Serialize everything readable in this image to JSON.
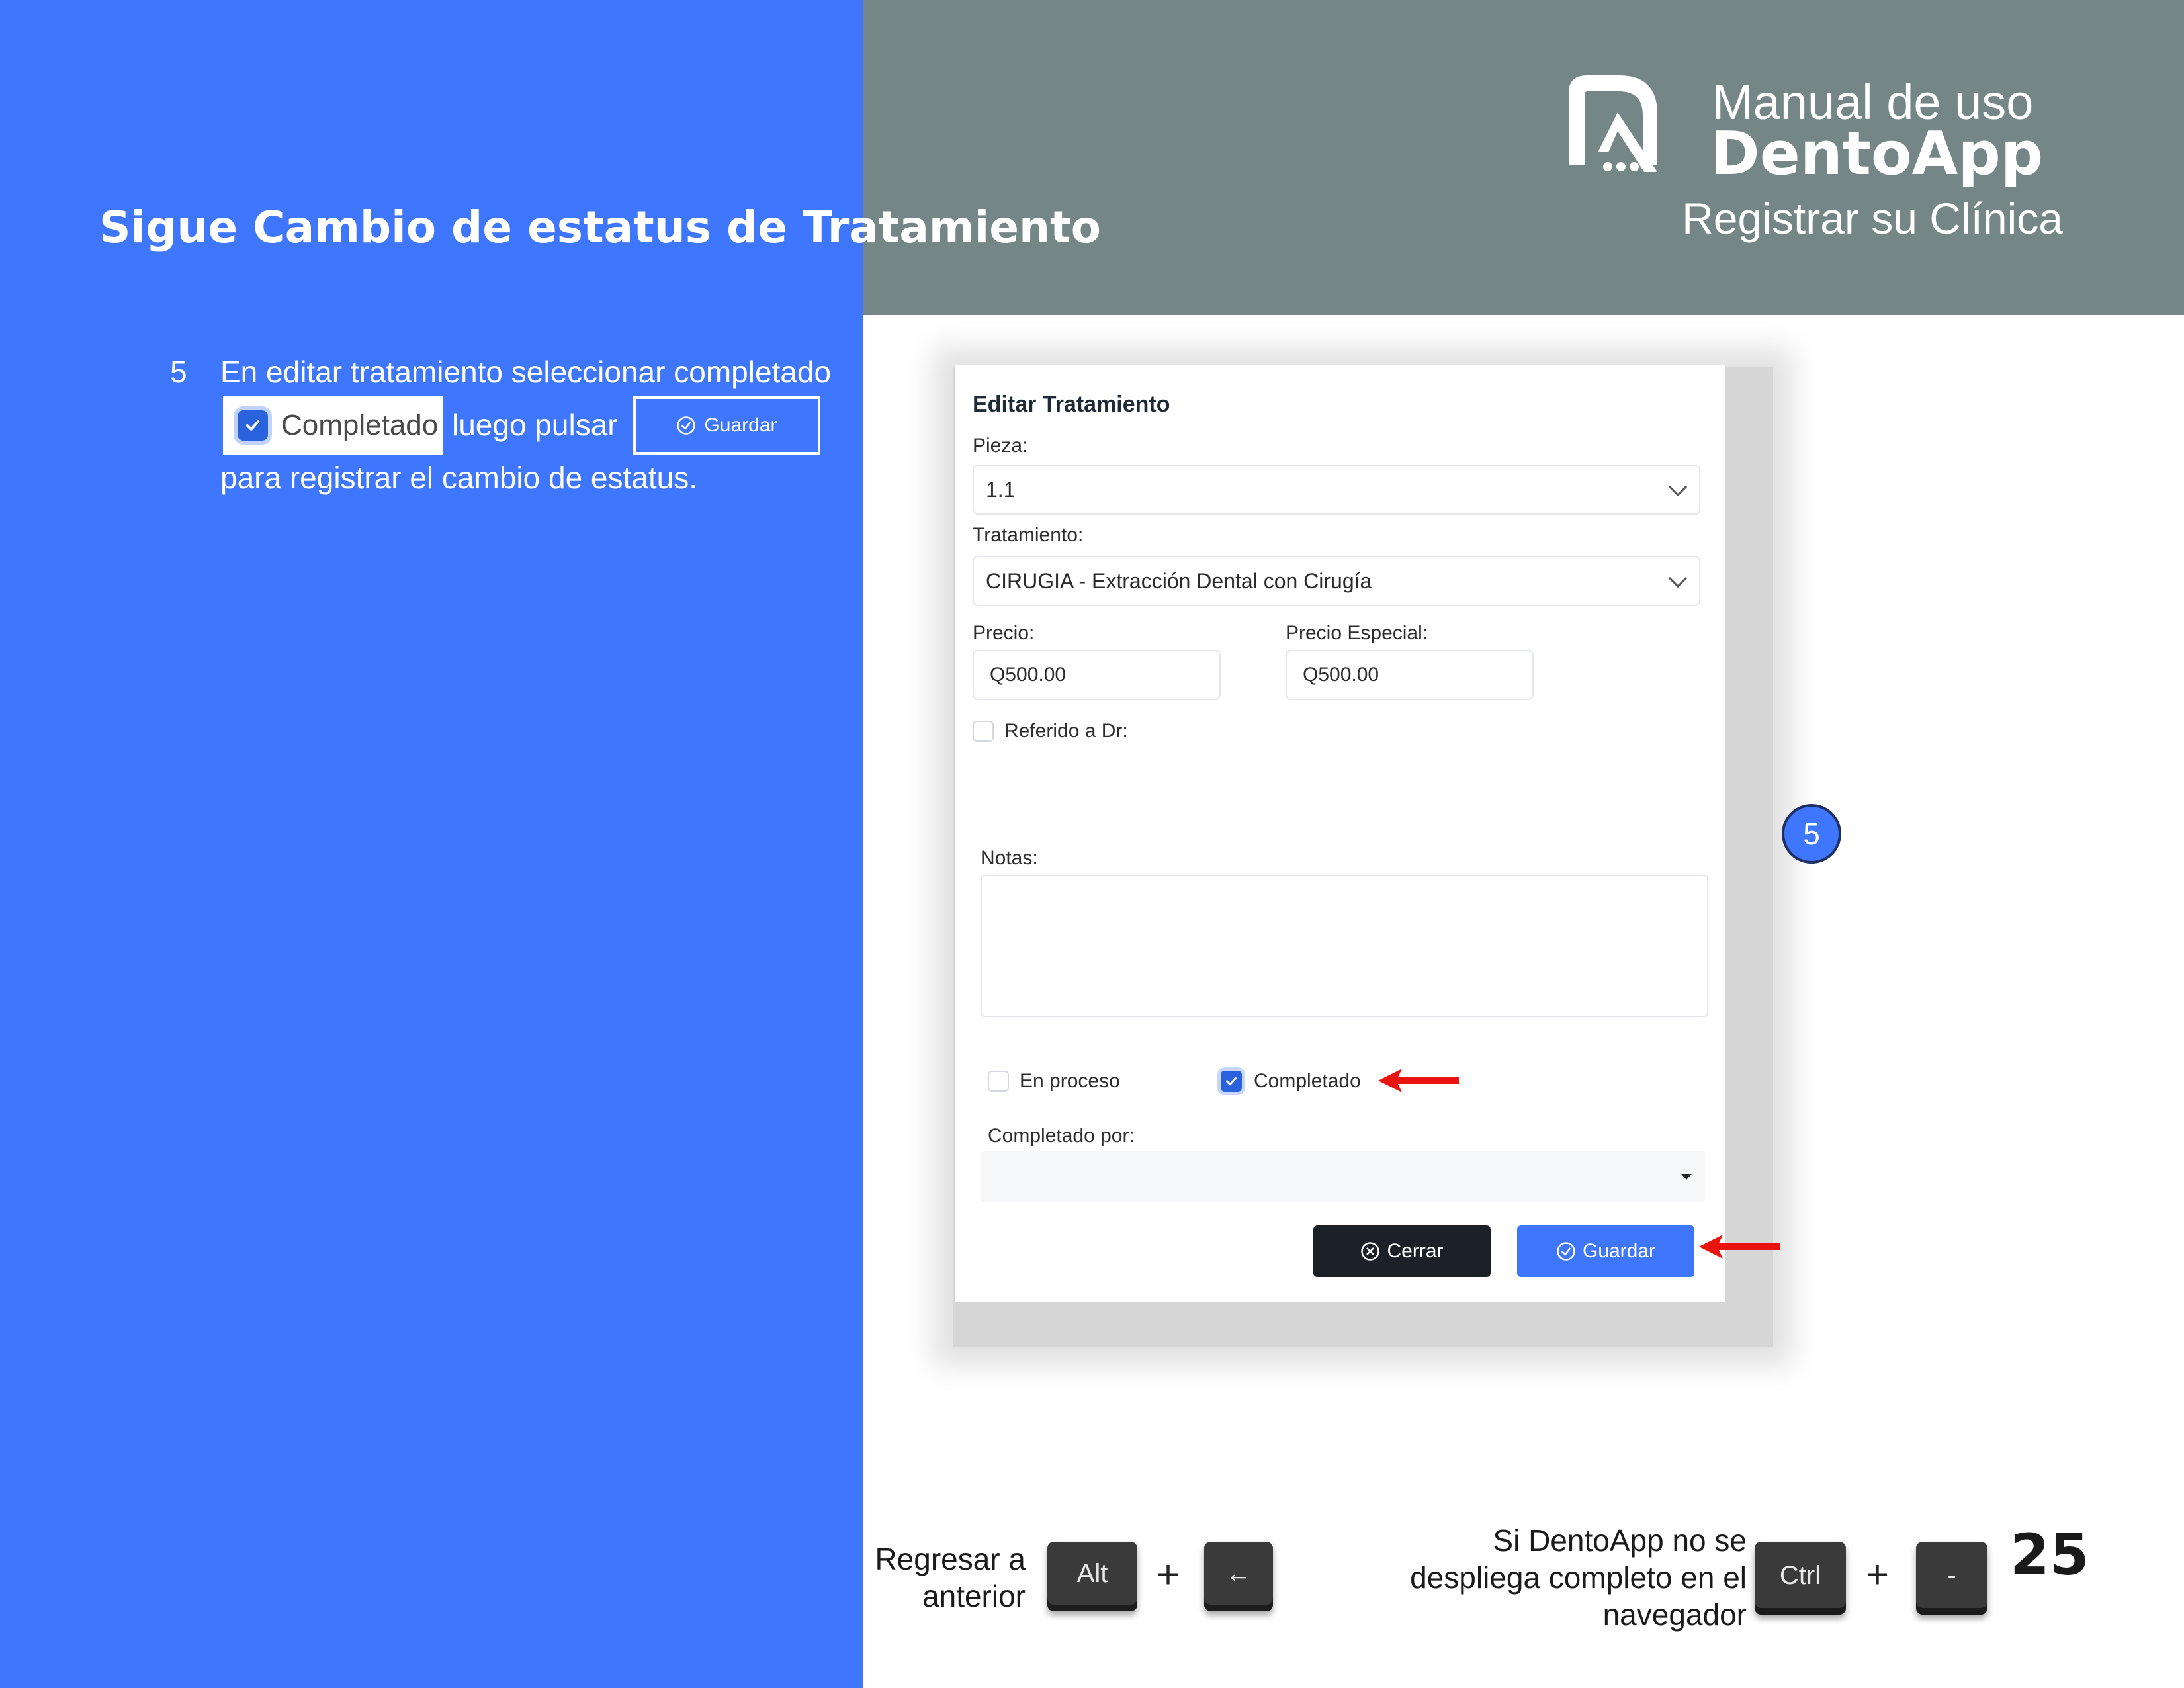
{
  "header": {
    "page_title": "Sigue Cambio de estatus de Tratamiento",
    "brand_line1": "Manual de uso",
    "brand_line2": "DentoApp",
    "brand_line3": "Registrar su Clínica",
    "logo_icon": "dentoapp-logo-icon"
  },
  "step": {
    "number": "5",
    "text_part1": "En editar tratamiento seleccionar completado",
    "inline_checkbox_label": "Completado",
    "text_part2": "luego pulsar",
    "inline_button_label": "Guardar",
    "text_part3": "para registrar el cambio de estatus."
  },
  "modal": {
    "title": "Editar Tratamiento",
    "pieza_label": "Pieza:",
    "pieza_value": "1.1",
    "tratamiento_label": "Tratamiento:",
    "tratamiento_value": "CIRUGIA - Extracción Dental con Cirugía",
    "precio_label": "Precio:",
    "precio_value": "Q500.00",
    "precio_especial_label": "Precio Especial:",
    "precio_especial_value": "Q500.00",
    "referido_label": "Referido a Dr:",
    "referido_checked": false,
    "notas_label": "Notas:",
    "notas_value": "",
    "en_proceso_label": "En proceso",
    "en_proceso_checked": false,
    "completado_label": "Completado",
    "completado_checked": true,
    "completado_por_label": "Completado por:",
    "completado_por_value": "",
    "cerrar_label": "Cerrar",
    "guardar_label": "Guardar"
  },
  "badge": "5",
  "footer": {
    "back_text": "Regresar a anterior",
    "back_key1": "Alt",
    "back_key2": "←",
    "zoom_text": "Si DentoApp no se despliega completo en el navegador",
    "zoom_key1": "Ctrl",
    "zoom_key2": "-",
    "plus": "+",
    "page_number": "25"
  },
  "colors": {
    "brand_blue": "#3e76fe",
    "header_grey": "#748685",
    "button_dark": "#1c2128",
    "arrow_red": "#e8140d"
  }
}
